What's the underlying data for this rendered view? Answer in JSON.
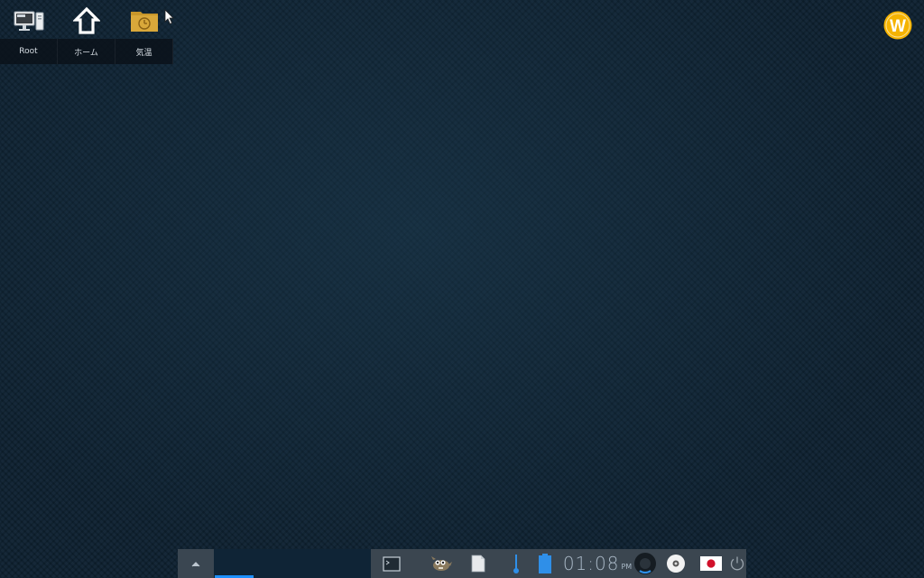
{
  "desktop_icons": [
    {
      "label": "Root",
      "icon": "computer-icon"
    },
    {
      "label": "ホーム",
      "icon": "home-icon"
    },
    {
      "label": "気温",
      "icon": "folder-clock-icon"
    }
  ],
  "logo_letter": "W",
  "taskbar": {
    "clock_time": "01:08",
    "clock_ampm": "PM",
    "tray_icons": [
      "terminal-icon",
      "gimp-icon",
      "document-icon",
      "thermometer-icon",
      "battery-icon",
      "volume-icon",
      "disc-icon",
      "japanese-flag-icon",
      "power-icon"
    ]
  },
  "colors": {
    "accent": "#1e90ff",
    "logo": "#f5b301",
    "folder": "#c8962a"
  }
}
